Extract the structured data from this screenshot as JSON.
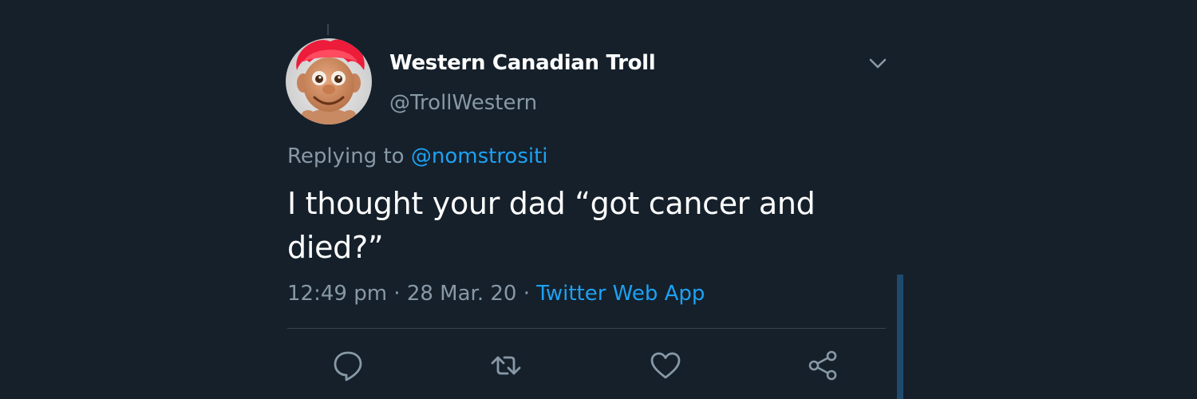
{
  "tweet": {
    "author": {
      "display_name": "Western Canadian Troll",
      "handle": "@TrollWestern"
    },
    "replying_prefix": "Replying to ",
    "replying_to": "@nomstrositi",
    "text": "I thought your dad “got cancer and died?”",
    "time": "12:49 pm",
    "separator": " · ",
    "date": "28 Mar. 20",
    "source": "Twitter Web App"
  },
  "actions": {
    "icons": [
      "reply-icon",
      "retweet-icon",
      "like-icon",
      "share-icon"
    ]
  },
  "colors": {
    "background": "#15202b",
    "primary_text": "#ffffff",
    "secondary_text": "#8899a6",
    "link": "#1da1f2",
    "divider": "#38444d"
  }
}
